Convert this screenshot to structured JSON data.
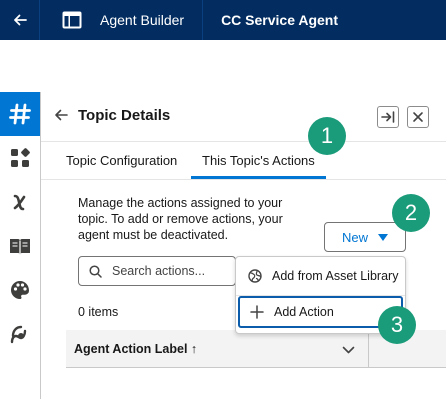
{
  "topbar": {
    "builder_title": "Agent Builder",
    "agent_name": "CC Service Agent"
  },
  "rail": {
    "icons": [
      "hash-icon",
      "components-icon",
      "variable-icon",
      "book-icon",
      "palette-icon",
      "wave-icon"
    ],
    "accent": "#0176d3"
  },
  "panel": {
    "title": "Topic Details",
    "tabs": [
      {
        "label": "Topic Configuration"
      },
      {
        "label": "This Topic's Actions"
      }
    ],
    "description": "Manage the actions assigned to your topic. To add or remove actions, your agent must be deactivated.",
    "new_button": "New",
    "search_placeholder": "Search actions...",
    "items_count": "0 items",
    "table": {
      "columns": [
        {
          "label": "Agent Action Label ↑"
        }
      ]
    }
  },
  "dropdown": {
    "items": [
      {
        "label": "Add from Asset Library"
      },
      {
        "label": "Add Action"
      }
    ]
  },
  "callouts": [
    "1",
    "2",
    "3"
  ],
  "colors": {
    "topbar": "#032d60",
    "brand": "#0176d3",
    "callout": "#1a9b7a"
  }
}
